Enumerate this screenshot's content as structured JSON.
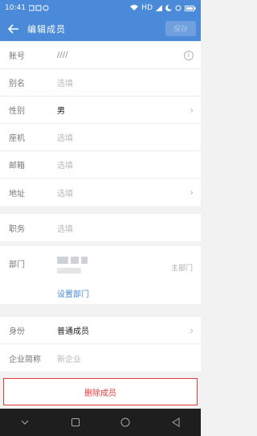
{
  "status_bar": {
    "time": "10:41",
    "signal": "HD"
  },
  "app_bar": {
    "title": "编辑成员",
    "save_label": "保存"
  },
  "basic_fields": [
    {
      "label": "账号",
      "value": "////",
      "placeholder": false
    },
    {
      "label": "别名",
      "value": "选填",
      "placeholder": true
    },
    {
      "label": "性别",
      "value": "男",
      "placeholder": false
    },
    {
      "label": "座机",
      "value": "选填",
      "placeholder": true
    },
    {
      "label": "邮箱",
      "value": "选填",
      "placeholder": true
    },
    {
      "label": "地址",
      "value": "选填",
      "placeholder": true
    }
  ],
  "position": {
    "label": "职务",
    "value": "选填"
  },
  "department": {
    "label": "部门",
    "main_tag": "主部门",
    "set_link": "设置部门"
  },
  "identity": {
    "label": "身份",
    "value": "普通成员"
  },
  "company_short": {
    "label": "企业简称",
    "value": "新企业"
  },
  "delete_label": "删除成员",
  "colors": {
    "primary": "#4a8ad8",
    "danger": "#e03b3b"
  }
}
